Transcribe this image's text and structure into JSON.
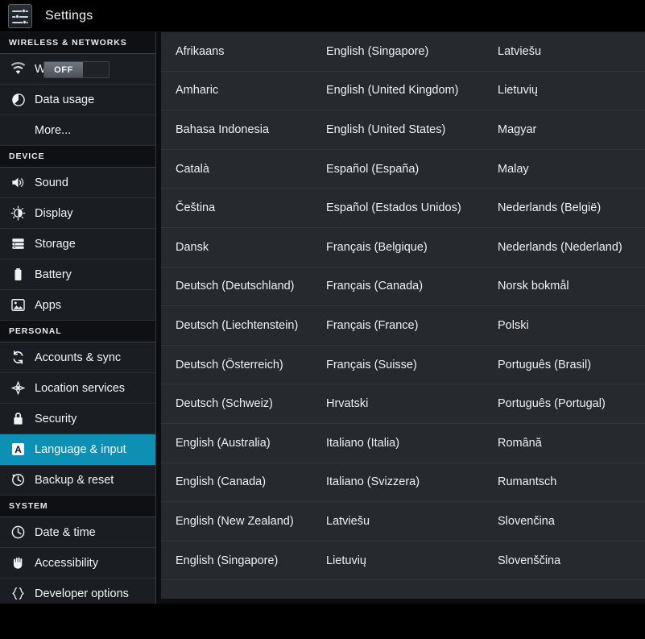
{
  "titlebar": {
    "app_icon_name": "settings-sliders-icon",
    "title": "Settings"
  },
  "sidebar": {
    "sections": [
      {
        "header": "WIRELESS & NETWORKS",
        "items": [
          {
            "label": "Wi-Fi",
            "icon": "wifi-icon",
            "toggle": {
              "label": "OFF",
              "state": "off"
            }
          },
          {
            "label": "Data usage",
            "icon": "data-usage-icon"
          },
          {
            "label": "More...",
            "icon": "none"
          }
        ]
      },
      {
        "header": "DEVICE",
        "items": [
          {
            "label": "Sound",
            "icon": "speaker-icon"
          },
          {
            "label": "Display",
            "icon": "brightness-icon"
          },
          {
            "label": "Storage",
            "icon": "storage-icon"
          },
          {
            "label": "Battery",
            "icon": "battery-icon"
          },
          {
            "label": "Apps",
            "icon": "apps-image-icon"
          }
        ]
      },
      {
        "header": "PERSONAL",
        "items": [
          {
            "label": "Accounts & sync",
            "icon": "sync-icon"
          },
          {
            "label": "Location services",
            "icon": "location-icon"
          },
          {
            "label": "Security",
            "icon": "lock-icon"
          },
          {
            "label": "Language & input",
            "icon": "language-a-icon",
            "selected": true
          },
          {
            "label": "Backup & reset",
            "icon": "backup-reset-icon"
          }
        ]
      },
      {
        "header": "SYSTEM",
        "items": [
          {
            "label": "Date & time",
            "icon": "clock-icon"
          },
          {
            "label": "Accessibility",
            "icon": "hand-icon"
          },
          {
            "label": "Developer options",
            "icon": "braces-icon"
          }
        ]
      }
    ],
    "selected_color": "#0e90b4"
  },
  "main": {
    "columns": 3,
    "rows": [
      [
        "Afrikaans",
        "English (Singapore)",
        "Latviešu"
      ],
      [
        "Amharic",
        "English (United Kingdom)",
        "Lietuvių"
      ],
      [
        "Bahasa Indonesia",
        "English (United States)",
        "Magyar"
      ],
      [
        "Català",
        "Español (España)",
        "Malay"
      ],
      [
        "Čeština",
        "Español (Estados Unidos)",
        "Nederlands (België)"
      ],
      [
        "Dansk",
        "Français (Belgique)",
        "Nederlands (Nederland)"
      ],
      [
        "Deutsch (Deutschland)",
        "Français (Canada)",
        "Norsk bokmål"
      ],
      [
        "Deutsch (Liechtenstein)",
        "Français (France)",
        "Polski"
      ],
      [
        "Deutsch (Österreich)",
        "Français (Suisse)",
        "Português (Brasil)"
      ],
      [
        "Deutsch (Schweiz)",
        "Hrvatski",
        "Português (Portugal)"
      ],
      [
        "English (Australia)",
        "Italiano (Italia)",
        "Română"
      ],
      [
        "English (Canada)",
        "Italiano (Svizzera)",
        "Rumantsch"
      ],
      [
        "English (New Zealand)",
        "Latviešu",
        "Slovenčina"
      ],
      [
        "English (Singapore)",
        "Lietuvių",
        "Slovenščina"
      ]
    ]
  }
}
